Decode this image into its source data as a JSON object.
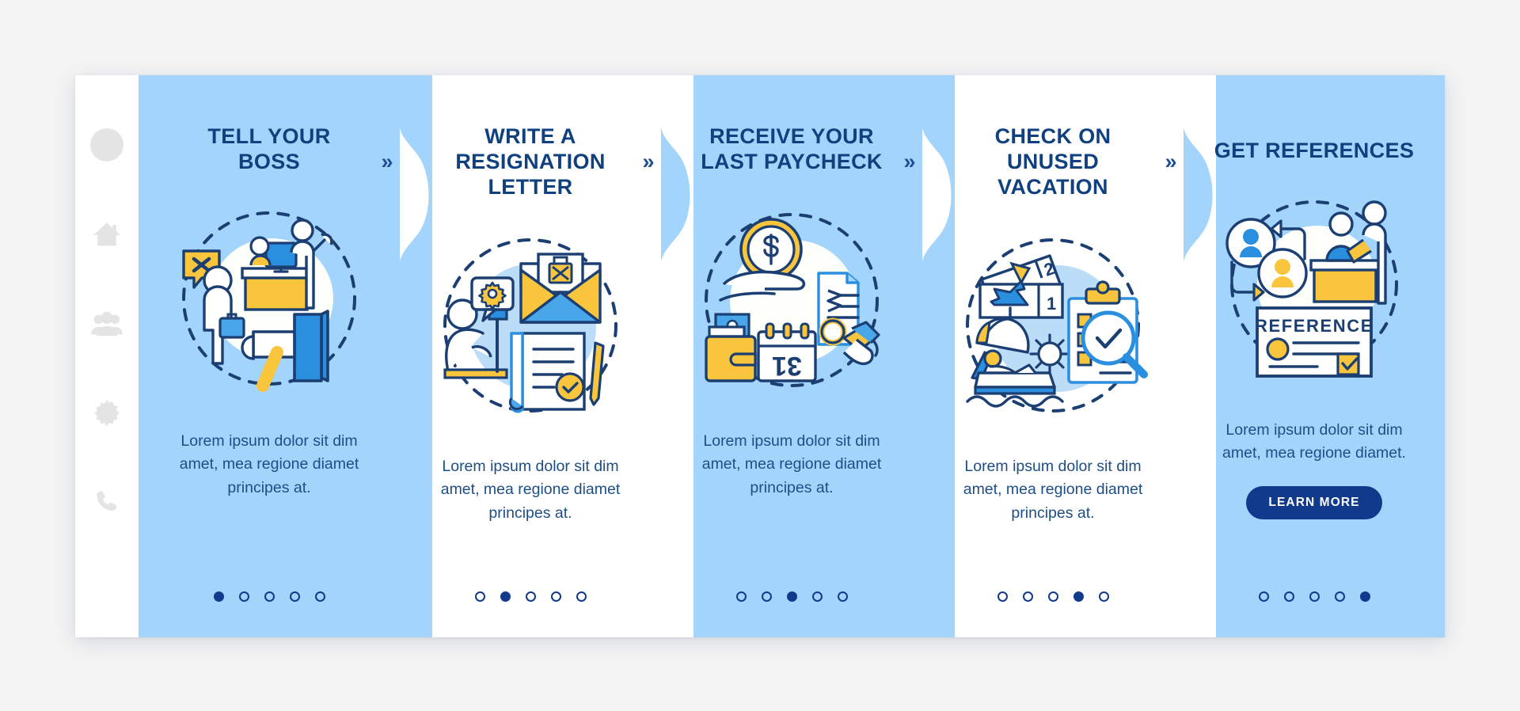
{
  "app": {
    "background_color": "#f4f4f4",
    "frame_background": "#ffffff",
    "accent_blue": "#a3d4fc",
    "title_navy": "#11407f",
    "button_navy": "#123a8c"
  },
  "sidebar": {
    "items": [
      {
        "icon": "user-avatar-icon",
        "label": "Profile"
      },
      {
        "icon": "home-icon",
        "label": "Home"
      },
      {
        "icon": "people-group-icon",
        "label": "Team"
      },
      {
        "icon": "gear-icon",
        "label": "Settings"
      },
      {
        "icon": "phone-icon",
        "label": "Contact"
      }
    ]
  },
  "separator": {
    "chevron": "»"
  },
  "cards": [
    {
      "title": "TELL YOUR\nBOSS",
      "body": "Lorem ipsum dolor sit dim amet, mea regione diamet principes at.",
      "illustration": "tell-your-boss-illustration",
      "theme": "blue",
      "dots": {
        "total": 5,
        "active": 1
      }
    },
    {
      "title": "WRITE A\nRESIGNATION LETTER",
      "body": "Lorem ipsum dolor sit dim amet, mea regione diamet principes at.",
      "illustration": "resignation-letter-illustration",
      "theme": "white",
      "dots": {
        "total": 5,
        "active": 2
      }
    },
    {
      "title": "RECEIVE YOUR\nLAST PAYCHECK",
      "body": "Lorem ipsum dolor sit dim amet, mea regione diamet principes at.",
      "illustration": "last-paycheck-illustration",
      "theme": "blue",
      "dots": {
        "total": 5,
        "active": 3
      }
    },
    {
      "title": "CHECK ON UNUSED\nVACATION",
      "body": "Lorem ipsum dolor sit dim amet, mea regione diamet principes at.",
      "illustration": "unused-vacation-illustration",
      "theme": "white",
      "dots": {
        "total": 5,
        "active": 4
      }
    },
    {
      "title": "GET REFERENCES",
      "body": "Lorem ipsum dolor sit dim amet, mea regione diamet.",
      "illustration": "get-references-illustration",
      "theme": "blue",
      "button_label": "LEARN MORE",
      "dots": {
        "total": 5,
        "active": 5
      }
    }
  ]
}
